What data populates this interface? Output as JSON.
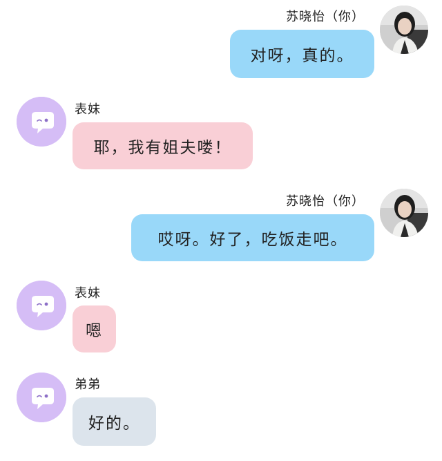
{
  "colors": {
    "me_bubble": "#99d8f9",
    "cousin_bubble": "#f9cfd6",
    "brother_bubble": "#dce4ec",
    "bot_avatar_bg": "#d5bdf6"
  },
  "messages": [
    {
      "sender": "苏晓怡（你）",
      "text": "对呀，真的。",
      "side": "right",
      "avatar_icon": "user-photo-avatar"
    },
    {
      "sender": "表妹",
      "text": "耶，我有姐夫喽！",
      "side": "left",
      "avatar_icon": "chat-bubble-face-icon"
    },
    {
      "sender": "苏晓怡（你）",
      "text": "哎呀。好了，吃饭走吧。",
      "side": "right",
      "avatar_icon": "user-photo-avatar"
    },
    {
      "sender": "表妹",
      "text": "嗯",
      "side": "left",
      "avatar_icon": "chat-bubble-face-icon"
    },
    {
      "sender": "弟弟",
      "text": "好的。",
      "side": "left",
      "avatar_icon": "chat-bubble-face-icon"
    }
  ]
}
